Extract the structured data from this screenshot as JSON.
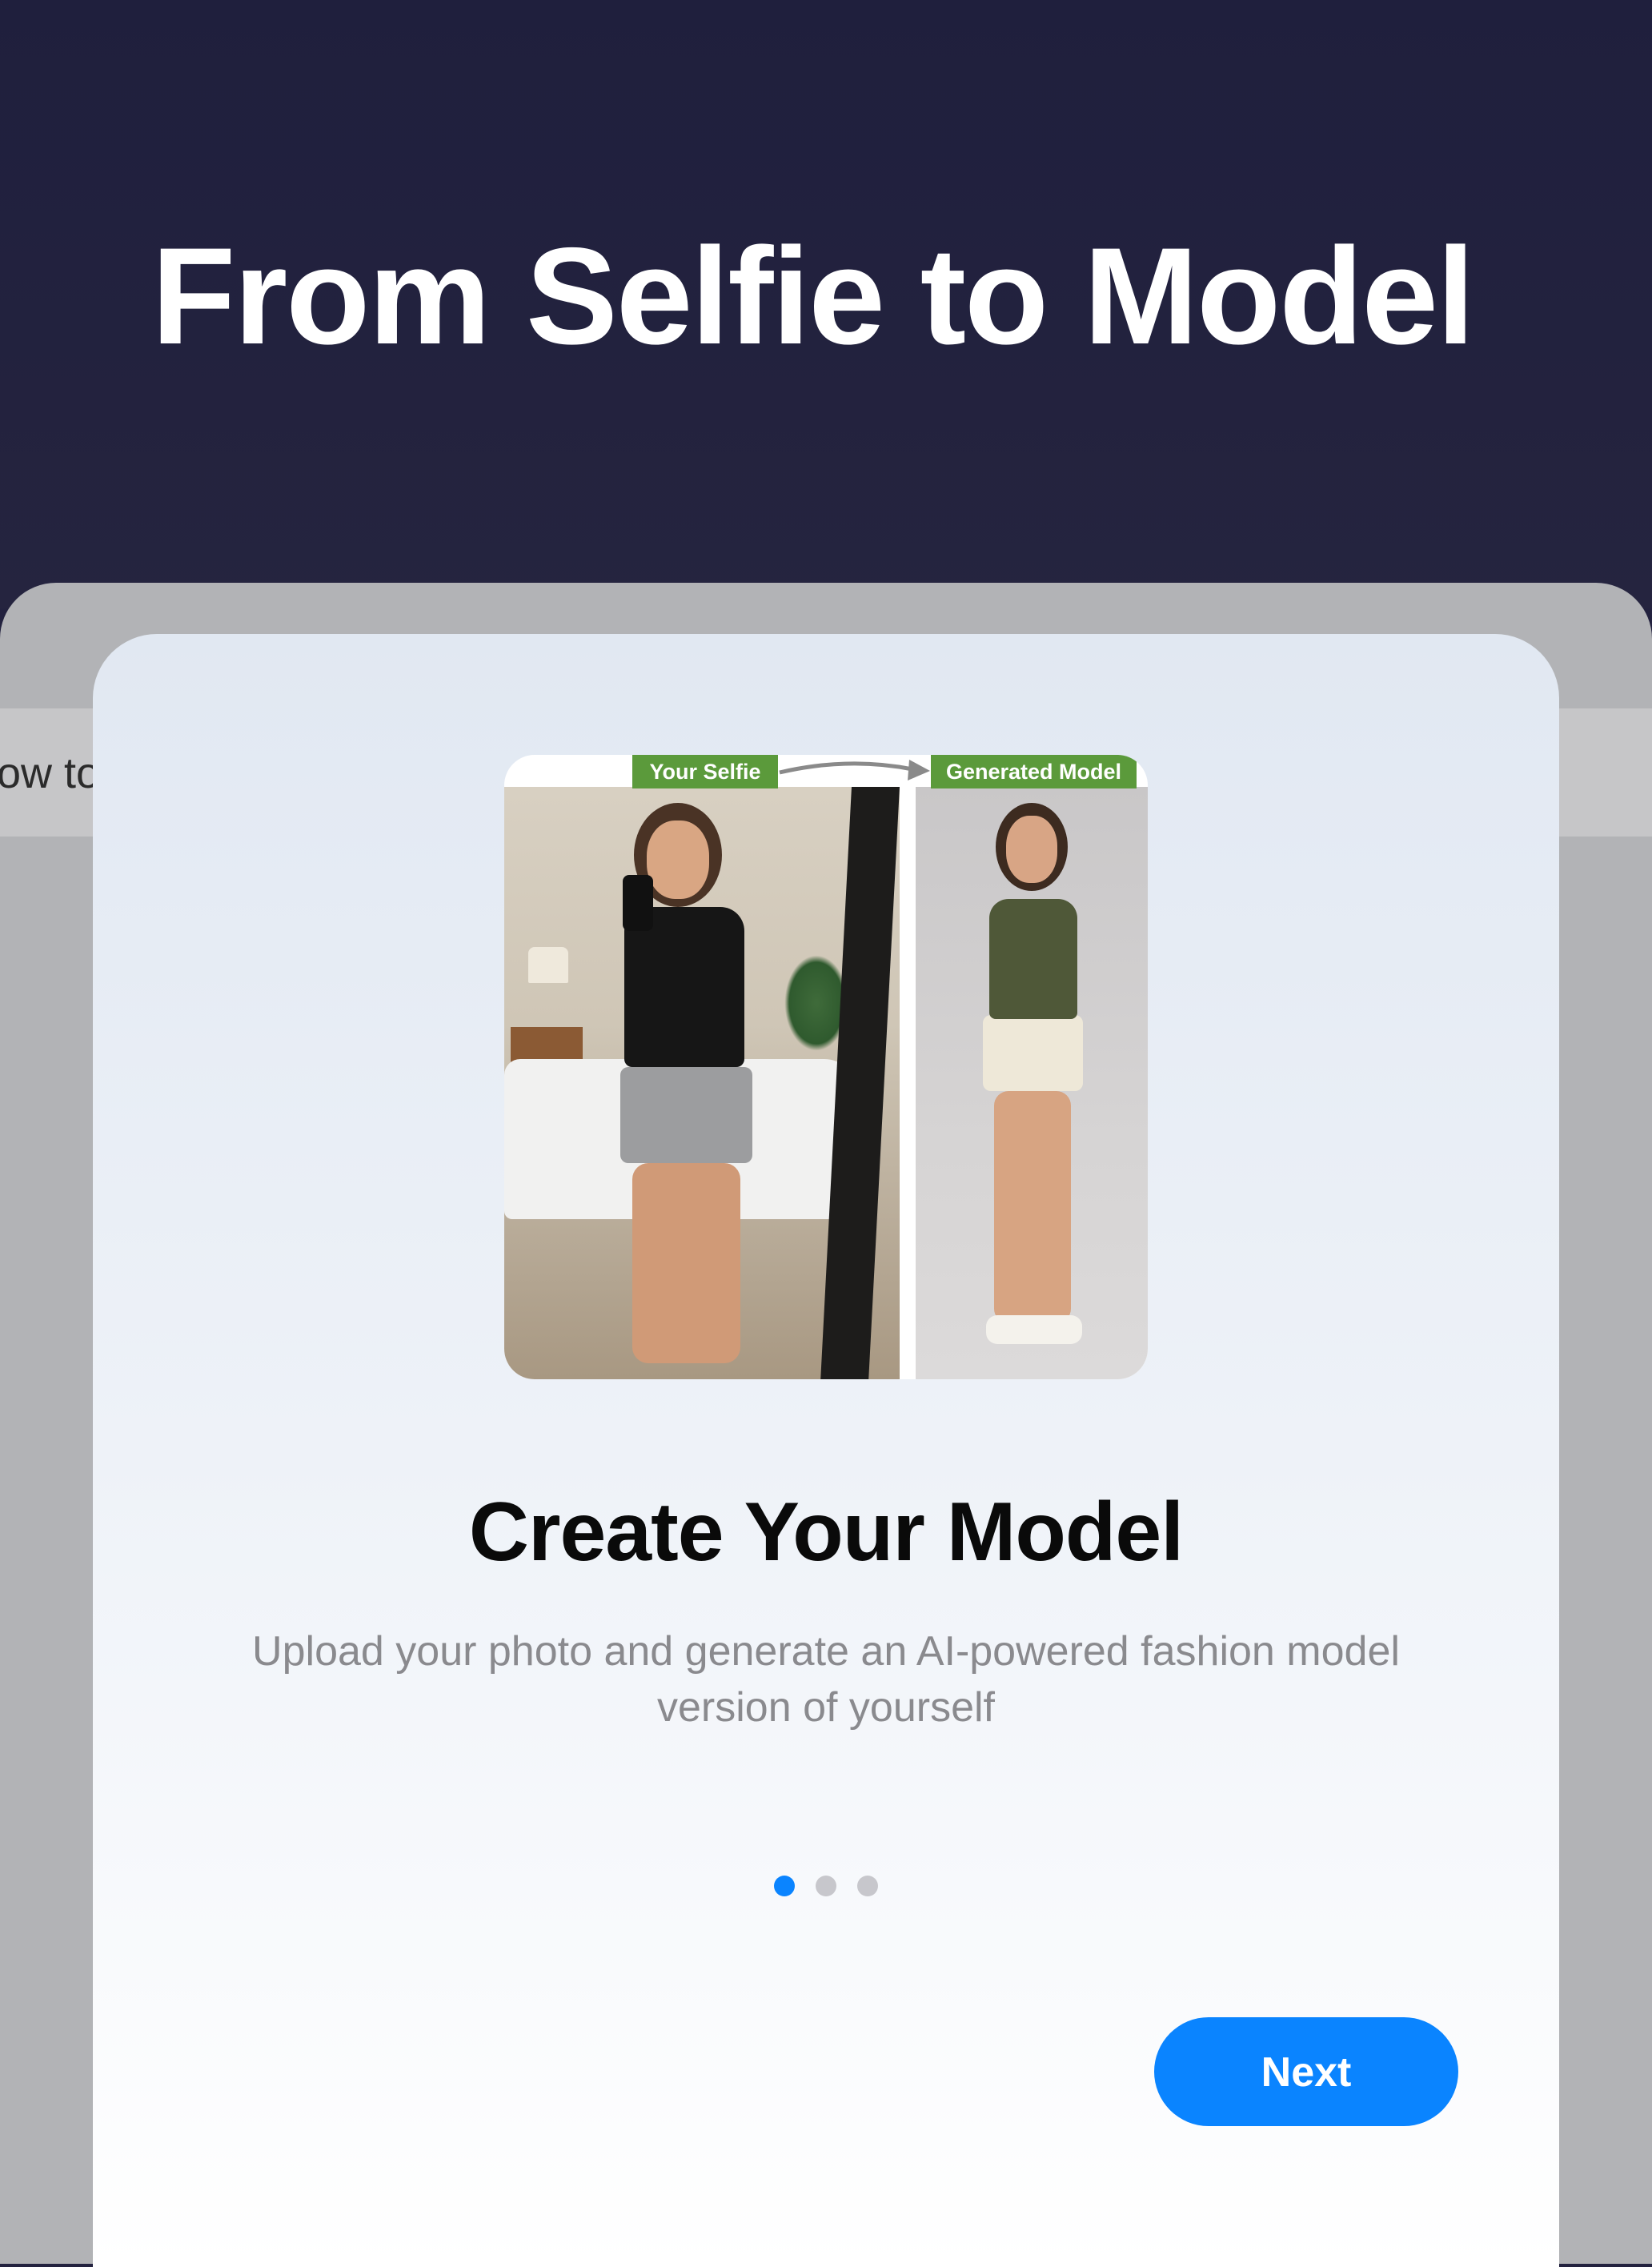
{
  "promo": {
    "title": "From Selfie to Model"
  },
  "background_app": {
    "partial_text": "ow to"
  },
  "onboarding": {
    "illustration": {
      "left_label": "Your Selfie",
      "right_label": "Generated Model"
    },
    "title": "Create Your Model",
    "description": "Upload your photo and generate an AI-powered fashion model version of yourself",
    "pager": {
      "total": 3,
      "active_index": 0
    },
    "next_label": "Next"
  },
  "colors": {
    "accent": "#0A84FF",
    "promo_background": "#23223F",
    "tag_green": "#5B9A3B"
  }
}
